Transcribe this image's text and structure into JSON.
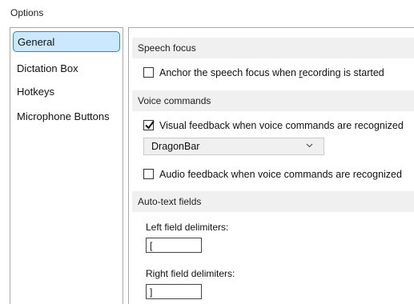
{
  "window": {
    "title": "Options"
  },
  "sidebar": {
    "items": [
      {
        "label": "General",
        "selected": true
      },
      {
        "label": "Dictation Box",
        "selected": false
      },
      {
        "label": "Hotkeys",
        "selected": false
      },
      {
        "label": "Microphone Buttons",
        "selected": false
      }
    ]
  },
  "sections": {
    "speech_focus": {
      "header": "Speech focus",
      "anchor": {
        "label_pre": "Anchor the speech focus when ",
        "label_key": "r",
        "label_post": "ecording is started",
        "checked": false
      }
    },
    "voice_commands": {
      "header": "Voice commands",
      "visual_feedback": {
        "label": "Visual feedback when voice commands are recognized",
        "checked": true
      },
      "feedback_target": {
        "selected": "DragonBar"
      },
      "audio_feedback": {
        "label": "Audio feedback when voice commands are recognized",
        "checked": false
      }
    },
    "auto_text": {
      "header": "Auto-text fields",
      "left": {
        "label": "Left field delimiters:",
        "value": "["
      },
      "right": {
        "label": "Right field delimiters:",
        "value": "]"
      }
    }
  },
  "colors": {
    "selection_bg": "#cce8ff",
    "selection_border": "#1f8ad2",
    "section_bg": "#f0f0f0"
  },
  "icons": {
    "check": "check-icon",
    "dropdown": "chevron-down-icon"
  }
}
